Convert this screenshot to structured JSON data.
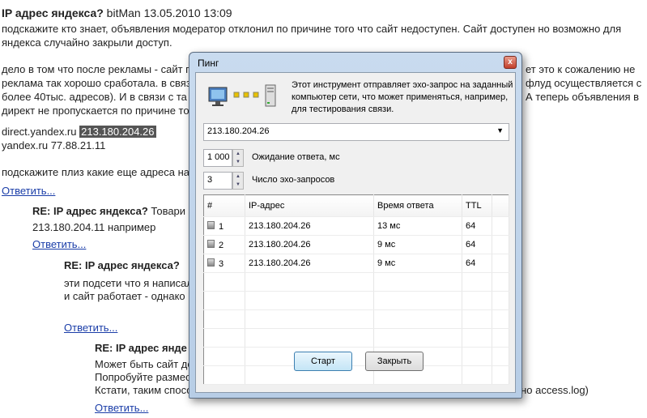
{
  "forum": {
    "post1": {
      "title": "IP адрес яндекса?",
      "meta": "bitMan 13.05.2010 13:09",
      "lines": [
        "подскажите кто знает, объявления модератор отклонил по причине того что сайт недоступен. Сайт доступен но возможно для",
        "яндекса случайно закрыли доступ."
      ],
      "para2_left": [
        "дело в том что после рекламы - сайт п",
        "реклама так хорошо сработала. в связ",
        "более 40тыс. адресов). И в связи с та",
        "директ не пропускается по причине то"
      ],
      "para2_right": [
        "ет это к сожалению не",
        "флуд осуществляется с",
        "А теперь объявления в"
      ],
      "direct_host": "direct.yandex.ru",
      "direct_ip": "213.180.204.26",
      "yandex_line": "yandex.ru 77.88.21.11",
      "question": "подскажите плиз какие еще адреса на"
    },
    "reply_label": "Ответить...",
    "reply1": {
      "title": "RE: IP адрес яндекса?",
      "meta": " Товари",
      "line": "213.180.204.11 например"
    },
    "reply2": {
      "title": "RE: IP адрес яндекса?",
      "lines": [
        "эти подсети что я написал",
        "и сайт работает - однако"
      ]
    },
    "reply3": {
      "title": "RE: IP адрес янде",
      "lines": [
        "Может быть сайт де",
        "Попробуйте размес",
        "Кстати, таким способом и IP узнаете - в файл логов запишется обращение к ней (обычно access.log)"
      ]
    }
  },
  "dialog": {
    "title": "Пинг",
    "close": "x",
    "description": "Этот инструмент отправляет эхо-запрос на заданный компьютер сети, что может применяться, например, для тестирования связи.",
    "host": "213.180.204.26",
    "timeout": {
      "value": "1 000",
      "label": "Ожидание ответа, мс"
    },
    "count": {
      "value": "3",
      "label": "Число эхо-запросов"
    },
    "columns": [
      "#",
      "IP-адрес",
      "Время ответа",
      "TTL"
    ],
    "rows": [
      {
        "n": "1",
        "ip": "213.180.204.26",
        "time": "13 мс",
        "ttl": "64"
      },
      {
        "n": "2",
        "ip": "213.180.204.26",
        "time": "9 мс",
        "ttl": "64"
      },
      {
        "n": "3",
        "ip": "213.180.204.26",
        "time": "9 мс",
        "ttl": "64"
      }
    ],
    "start": "Старт",
    "close_button": "Закрыть"
  }
}
